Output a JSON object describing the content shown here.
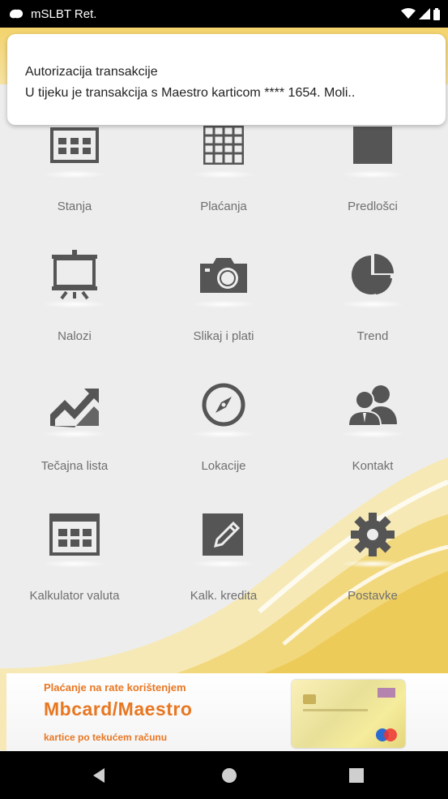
{
  "status_bar": {
    "app_name": "mSLBT Ret."
  },
  "notification": {
    "title": "Autorizacija transakcije",
    "body": "U tijeku je transakcija s Maestro karticom **** 1654. Moli.."
  },
  "tiles": [
    {
      "label": "Stanja",
      "icon": "account-balance-icon"
    },
    {
      "label": "Plaćanja",
      "icon": "payments-grid-icon"
    },
    {
      "label": "Predlošci",
      "icon": "templates-icon"
    },
    {
      "label": "Nalozi",
      "icon": "presentation-board-icon"
    },
    {
      "label": "Slikaj i plati",
      "icon": "camera-icon"
    },
    {
      "label": "Trend",
      "icon": "pie-chart-icon"
    },
    {
      "label": "Tečajna lista",
      "icon": "trend-chart-icon"
    },
    {
      "label": "Lokacije",
      "icon": "compass-icon"
    },
    {
      "label": "Kontakt",
      "icon": "people-icon"
    },
    {
      "label": "Kalkulator valuta",
      "icon": "calculator-icon"
    },
    {
      "label": "Kalk. kredita",
      "icon": "edit-note-icon"
    },
    {
      "label": "Postavke",
      "icon": "gear-icon"
    }
  ],
  "banner": {
    "line1": "Plaćanje na rate korištenjem",
    "line2": "Mbcard/Maestro",
    "line3": "kartice po tekućem računu"
  },
  "colors": {
    "icon_gray": "#555555",
    "label_gray": "#6f6f6f",
    "accent_orange": "#e87722",
    "accent_yellow": "#f3d36c"
  }
}
